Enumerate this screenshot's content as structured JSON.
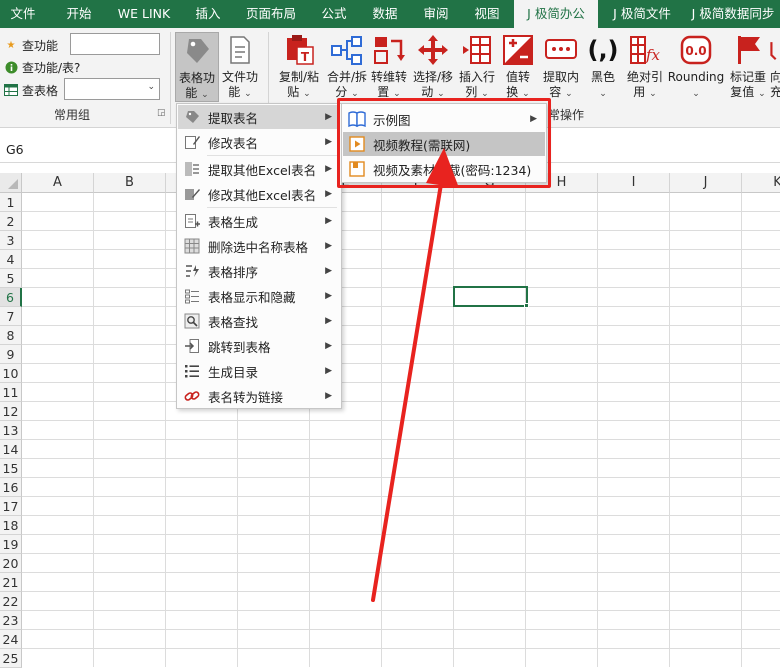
{
  "tabs": [
    "文件",
    "开始",
    "WE LINK",
    "插入",
    "页面布局",
    "公式",
    "数据",
    "审阅",
    "视图",
    "J 极简办公",
    "J 极简文件",
    "J 极简数据同步"
  ],
  "ribbon": {
    "left_rows": [
      {
        "icon": "star-icon",
        "label": "查功能"
      },
      {
        "icon": "info-icon",
        "label": "查功能/表?"
      },
      {
        "icon": "table-icon",
        "label": "查表格"
      }
    ],
    "group_common": "常用组",
    "group_daily": "日常操作",
    "buttons": [
      {
        "name": "table-function-button",
        "label": [
          "表格功",
          "能"
        ],
        "icon": "tag-icon"
      },
      {
        "name": "file-function-button",
        "label": [
          "文件功",
          "能"
        ],
        "icon": "document-icon"
      },
      {
        "name": "copy-paste-button",
        "label": [
          "复制/粘",
          "贴"
        ],
        "icon": "paste-icon"
      },
      {
        "name": "merge-split-button",
        "label": [
          "合并/拆",
          "分"
        ],
        "icon": "merge-icon"
      },
      {
        "name": "transpose-button",
        "label": [
          "转维转",
          "置"
        ],
        "icon": "transpose-icon"
      },
      {
        "name": "select-move-button",
        "label": [
          "选择/移",
          "动"
        ],
        "icon": "move-icon"
      },
      {
        "name": "insert-row-button",
        "label": [
          "插入行",
          "列"
        ],
        "icon": "insert-row-icon"
      },
      {
        "name": "value-convert-button",
        "label": [
          "值转",
          "换"
        ],
        "icon": "plus-minus-icon"
      },
      {
        "name": "extract-content-button",
        "label": [
          "提取内",
          "容"
        ],
        "icon": "extract-icon"
      },
      {
        "name": "black-button",
        "label": [
          "黑色",
          ""
        ],
        "icon": "parenthesis-icon"
      },
      {
        "name": "absolute-ref-button",
        "label": [
          "绝对引",
          "用"
        ],
        "icon": "fx-icon"
      },
      {
        "name": "rounding-button",
        "label": [
          "Rounding",
          ""
        ],
        "icon": "rounding-icon"
      },
      {
        "name": "mark-duplicate-button",
        "label": [
          "标记重",
          "复值"
        ],
        "icon": "flag-icon"
      },
      {
        "name": "direction-button",
        "label": [
          "向",
          "充"
        ],
        "icon": "arrow-down-icon"
      }
    ]
  },
  "name_box": "G6",
  "columns": [
    "A",
    "B",
    "C",
    "D",
    "E",
    "F",
    "G",
    "H",
    "I",
    "J",
    "K"
  ],
  "rows": [
    "1",
    "2",
    "3",
    "4",
    "5",
    "6",
    "7",
    "8",
    "9",
    "10",
    "11",
    "12",
    "13",
    "14",
    "15",
    "16",
    "17",
    "18",
    "19",
    "20",
    "21",
    "22",
    "23",
    "24",
    "25"
  ],
  "menu": [
    {
      "label": "提取表名",
      "icon": "tag-icon"
    },
    {
      "label": "修改表名",
      "icon": "edit-icon"
    },
    {
      "label": "提取其他Excel表名",
      "icon": "list-extract-icon"
    },
    {
      "label": "修改其他Excel表名",
      "icon": "pencil-icon"
    },
    {
      "label": "表格生成",
      "icon": "table-add-icon"
    },
    {
      "label": "删除选中名称表格",
      "icon": "table-grid-icon"
    },
    {
      "label": "表格排序",
      "icon": "sort-icon"
    },
    {
      "label": "表格显示和隐藏",
      "icon": "show-hide-icon"
    },
    {
      "label": "表格查找",
      "icon": "find-icon"
    },
    {
      "label": "跳转到表格",
      "icon": "jump-icon"
    },
    {
      "label": "生成目录",
      "icon": "toc-icon"
    },
    {
      "label": "表名转为链接",
      "icon": "link-icon"
    }
  ],
  "submenu": [
    {
      "label": "示例图",
      "icon": "book-icon"
    },
    {
      "label": "视频教程(需联网)",
      "icon": "play-icon"
    },
    {
      "label": "视频及素材下载(密码:1234)",
      "icon": "download-icon"
    }
  ],
  "colors": {
    "excel_green": "#217346",
    "highlight_red": "#e8231f"
  }
}
